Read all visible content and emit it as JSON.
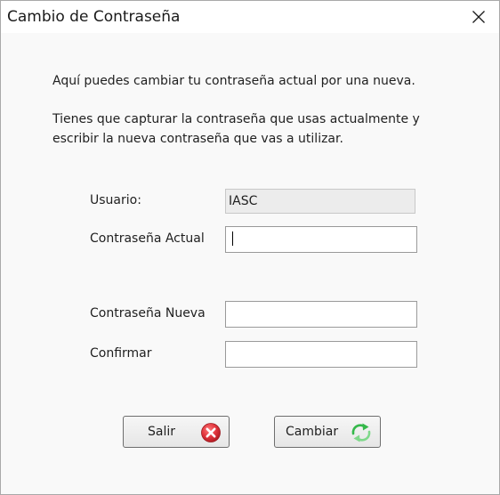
{
  "window": {
    "title": "Cambio de Contraseña"
  },
  "intro": {
    "line1": "Aquí puedes cambiar tu contraseña actual por una nueva.",
    "line2": "Tienes que capturar la contraseña que usas actualmente y",
    "line3": "escribir la nueva contraseña que vas a utilizar."
  },
  "form": {
    "usuario_label": "Usuario:",
    "usuario_value": "IASC",
    "actual_label": "Contraseña Actual",
    "actual_value": "",
    "nueva_label": "Contraseña Nueva",
    "nueva_value": "",
    "confirmar_label": "Confirmar",
    "confirmar_value": ""
  },
  "buttons": {
    "salir_label": "Salir",
    "salir_icon": "red-x-icon",
    "cambiar_label": "Cambiar",
    "cambiar_icon": "green-refresh-arrows-icon"
  },
  "colors": {
    "close_icon_red": "#e0343c",
    "refresh_green": "#35b84a"
  }
}
